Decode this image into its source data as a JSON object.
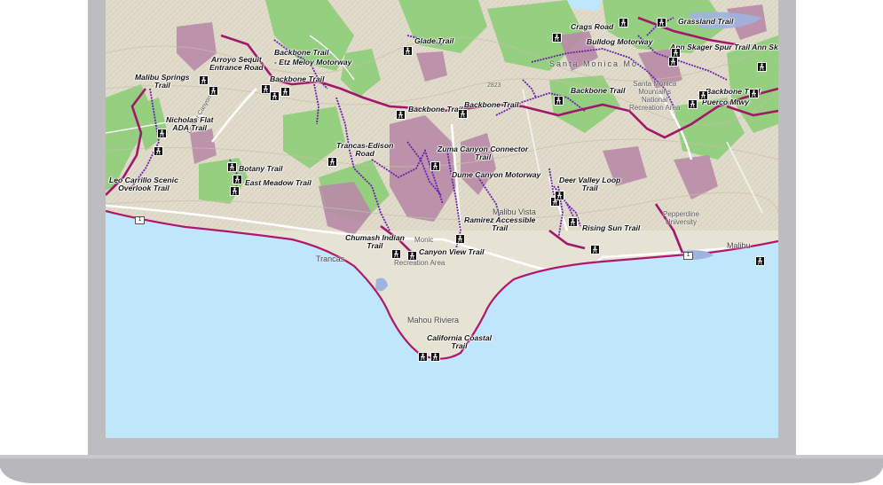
{
  "trails": {
    "backbone_1": "Backbone Trail",
    "backbone_2": "Backbone Trail",
    "backbone_3": "Backbone Trail",
    "backbone_4": "Backbone Trail",
    "backbone_5": "Backbone Trail",
    "backbone_6": "Backbone Trail",
    "glade": "Glade Trail",
    "crags": "Crags Road",
    "bulldog": "Bulldog Motorway",
    "grassland": "Grassland Trail",
    "ann_skager": "Ann Skager Spur Trail Ann Skag",
    "arroyo_line1": "Arroyo Sequit",
    "arroyo_line2": "Entrance Road",
    "etz_meloy": "- Etz Meloy Motorway",
    "malibu_springs_line1": "Malibu Springs",
    "malibu_springs_line2": "Trail",
    "nicholas_line1": "Nicholas Flat",
    "nicholas_line2": "ADA Trail",
    "trancas_line1": "Trancas-Edison",
    "trancas_line2": "Road",
    "zuma_line1": "Zuma Canyon Connector",
    "zuma_line2": "Trail",
    "dume": "Dume Canyon Motorway",
    "botany": "Botany Trail",
    "east_meadow": "East Meadow Trail",
    "leo_line1": "Leo Carrillo Scenic",
    "leo_line2": "Overlook Trail",
    "deer_line1": "Deer Valley Loop",
    "deer_line2": "Trail",
    "ramirez_line1": "Ramirez Accessible",
    "ramirez_line2": "Trail",
    "chumash_line1": "Chumash Indian",
    "chumash_line2": "Trail",
    "canyon_view": "Canyon View Trail",
    "rising_sun": "Rising Sun Trail",
    "puerco": "Puerco Mtwy",
    "california_line1": "California Coastal",
    "california_line2": "Trail"
  },
  "places": {
    "santa_monica": "Santa Monica Mo",
    "smm_line1": "Santa Monica",
    "smm_line2": "Mountains",
    "smm_line3": "National",
    "smm_line4": "Recreation Area",
    "malibu_vista": "Malibu Vista",
    "pepperdine_line1": "Pepperdine",
    "pepperdine_line2": "University",
    "malibu": "Malibu",
    "trancas": "Trancas",
    "mahou": "Mahou Riviera",
    "recreation_area": "Recreation Area",
    "monica": "Monic",
    "decker_road": "Decker Canyon Rd",
    "elevation": "2823"
  },
  "road_shields": {
    "shield_1": "1",
    "shield_2": "1"
  },
  "colors": {
    "ocean": "#bfe6fb",
    "land": "#e9e6dc",
    "park_green": "#8fce7a",
    "private_mauve": "#b98ba8",
    "trail_purple": "#6b1fb0",
    "trail_magenta": "#a3176b",
    "coastline": "#b0166c",
    "laptop_frame": "#bdbdbf"
  },
  "icons": {
    "trailhead": "hiker-icon"
  }
}
